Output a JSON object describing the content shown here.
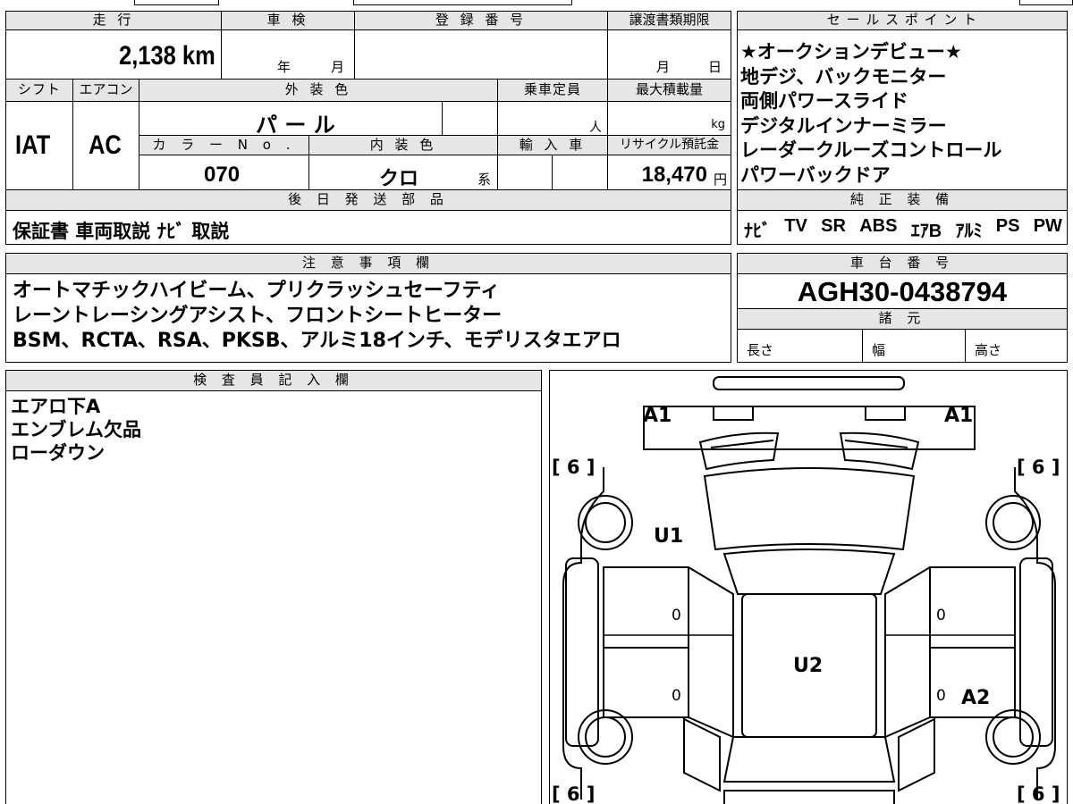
{
  "headers": {
    "mileage": "走 行",
    "shaken": "車 検",
    "reg_number": "登 録 番 号",
    "transfer_deadline": "譲渡書類期限",
    "sales_points": "セ ー ル ス ポ イ ン ト",
    "shift": "シフト",
    "aircon": "エアコン",
    "exterior_color": "外 装 色",
    "capacity": "乗車定員",
    "max_load": "最大積載量",
    "color_no": "カ ラ ー N o .",
    "interior_color": "内 装 色",
    "import": "輸 入 車",
    "recycle": "リサイクル預託金",
    "later_parts": "後 日 発 送 部 品",
    "genuine_equipment": "純 正 装 備",
    "notes": "注 意 事 項 欄",
    "chassis_number": "車 台 番 号",
    "specs": "諸 元",
    "inspector": "検 査 員 記 入 欄"
  },
  "values": {
    "mileage": "2,138 km",
    "year_unit": "年",
    "month_unit": "月",
    "deadline_month": "月",
    "deadline_day": "日",
    "shift": "IAT",
    "aircon": "AC",
    "exterior_color": "パ ー ル",
    "capacity_unit": "人",
    "load_unit": "kg",
    "color_no": "070",
    "interior_color": "クロ",
    "interior_suffix": "系",
    "recycle_fee": "18,470",
    "recycle_unit": "円",
    "later_parts": "保証書  車両取説  ﾅﾋﾞ 取説",
    "chassis_number": "AGH30-0438794",
    "length_label": "長さ",
    "width_label": "幅",
    "height_label": "高さ"
  },
  "sales_points": [
    "★オークションデビュー★",
    "地デジ、バックモニター",
    "両側パワースライド",
    "デジタルインナーミラー",
    "レーダークルーズコントロール",
    "パワーバックドア"
  ],
  "equipment": [
    "ﾅﾋﾞ",
    "TV",
    "SR",
    "ABS",
    "ｴｱB",
    "ｱﾙﾐ",
    "PS",
    "PW"
  ],
  "notes": [
    "オートマチックハイビーム、プリクラッシュセーフティ",
    "レーントレーシングアシスト、フロントシートヒーター",
    "BSM、RCTA、RSA、PKSB、アルミ18インチ、モデリスタエアロ"
  ],
  "inspector_notes": [
    "エアロ下A",
    "エンブレム欠品",
    "ローダウン"
  ],
  "diagram_marks": {
    "a1_left": "A1",
    "a1_right": "A1",
    "u1": "U1",
    "u2": "U2",
    "a2": "A2",
    "tyre_tl": "[ 6 ]",
    "tyre_tr": "[ 6 ]",
    "tyre_bl": "[ 6 ]",
    "tyre_br": "[ 6 ]",
    "door_fl": "0",
    "door_rl": "0",
    "door_fr": "0",
    "door_rr": "0"
  }
}
